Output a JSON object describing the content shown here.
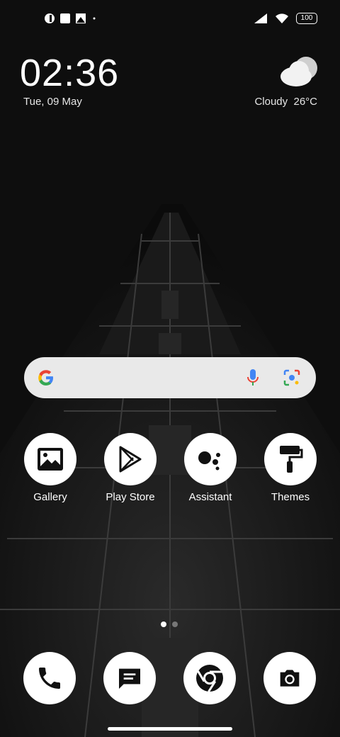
{
  "status_bar": {
    "notification_icons": [
      "notification-app-icon",
      "square-icon",
      "image-icon",
      "dot-icon"
    ],
    "system_icons": [
      "signal-icon",
      "wifi-icon",
      "battery-icon"
    ],
    "battery_level": "100"
  },
  "clock_widget": {
    "time": "02:36",
    "date": "Tue, 09 May"
  },
  "weather_widget": {
    "condition": "Cloudy",
    "temperature": "26°C",
    "icon": "cloud-icon"
  },
  "search_bar": {
    "icons": [
      "google-logo-icon",
      "microphone-icon",
      "lens-icon"
    ]
  },
  "apps": [
    {
      "label": "Gallery",
      "icon": "gallery-icon"
    },
    {
      "label": "Play Store",
      "icon": "play-store-icon"
    },
    {
      "label": "Assistant",
      "icon": "assistant-icon"
    },
    {
      "label": "Themes",
      "icon": "paint-roller-icon"
    }
  ],
  "page_indicator": {
    "pages": 2,
    "current": 1
  },
  "dock": [
    {
      "icon": "phone-icon"
    },
    {
      "icon": "messages-icon"
    },
    {
      "icon": "chrome-icon"
    },
    {
      "icon": "camera-icon"
    }
  ],
  "colors": {
    "background": "#0d0d0d",
    "icon_circle": "#ffffff",
    "search_bar": "#e9e9e9"
  }
}
